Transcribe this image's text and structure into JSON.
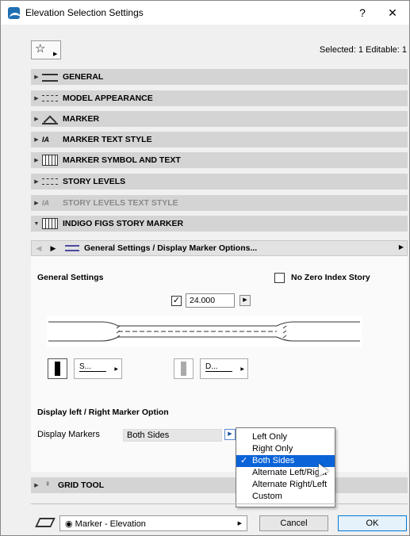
{
  "window": {
    "title": "Elevation Selection Settings",
    "help_label": "?",
    "close_label": "✕"
  },
  "toolbar": {
    "favorites_icon": "☆",
    "selected_info": "Selected: 1 Editable: 1"
  },
  "panels": [
    {
      "label": "GENERAL",
      "icon": "general-icon",
      "expanded": false,
      "dim": false
    },
    {
      "label": "MODEL APPEARANCE",
      "icon": "model-appearance-icon",
      "expanded": false,
      "dim": false
    },
    {
      "label": "MARKER",
      "icon": "marker-icon",
      "expanded": false,
      "dim": false
    },
    {
      "label": "MARKER TEXT STYLE",
      "icon": "text-style-icon",
      "expanded": false,
      "dim": false
    },
    {
      "label": "MARKER SYMBOL AND TEXT",
      "icon": "symbol-text-icon",
      "expanded": false,
      "dim": false
    },
    {
      "label": "STORY LEVELS",
      "icon": "story-levels-icon",
      "expanded": false,
      "dim": false
    },
    {
      "label": "STORY LEVELS TEXT STYLE",
      "icon": "text-style-icon",
      "expanded": false,
      "dim": true
    },
    {
      "label": "INDIGO FIGS STORY MARKER",
      "icon": "symbol-text-icon",
      "expanded": true,
      "dim": false
    }
  ],
  "subpage": {
    "title": "General Settings / Display Marker Options..."
  },
  "general_settings": {
    "heading": "General Settings",
    "no_zero_label": "No Zero Index Story",
    "no_zero_checked": false,
    "value_checked": true,
    "value": "24.000",
    "style_left_label": "S...",
    "style_right_label": "D..."
  },
  "display_option": {
    "heading": "Display left / Right Marker Option",
    "display_markers_label": "Display Markers",
    "selected_value": "Both Sides",
    "options": [
      "Left Only",
      "Right Only",
      "Both Sides",
      "Alternate Left/Right",
      "Alternate Right/Left",
      "Custom"
    ],
    "selected_index": 2
  },
  "grid_tool_panel": {
    "label": "GRID TOOL"
  },
  "footer": {
    "layer": "Marker - Elevation",
    "cancel_label": "Cancel",
    "ok_label": "OK"
  },
  "colors": {
    "selection": "#0a64d8",
    "panel_header": "#d4d4d4",
    "primary_button_border": "#0078d7"
  }
}
